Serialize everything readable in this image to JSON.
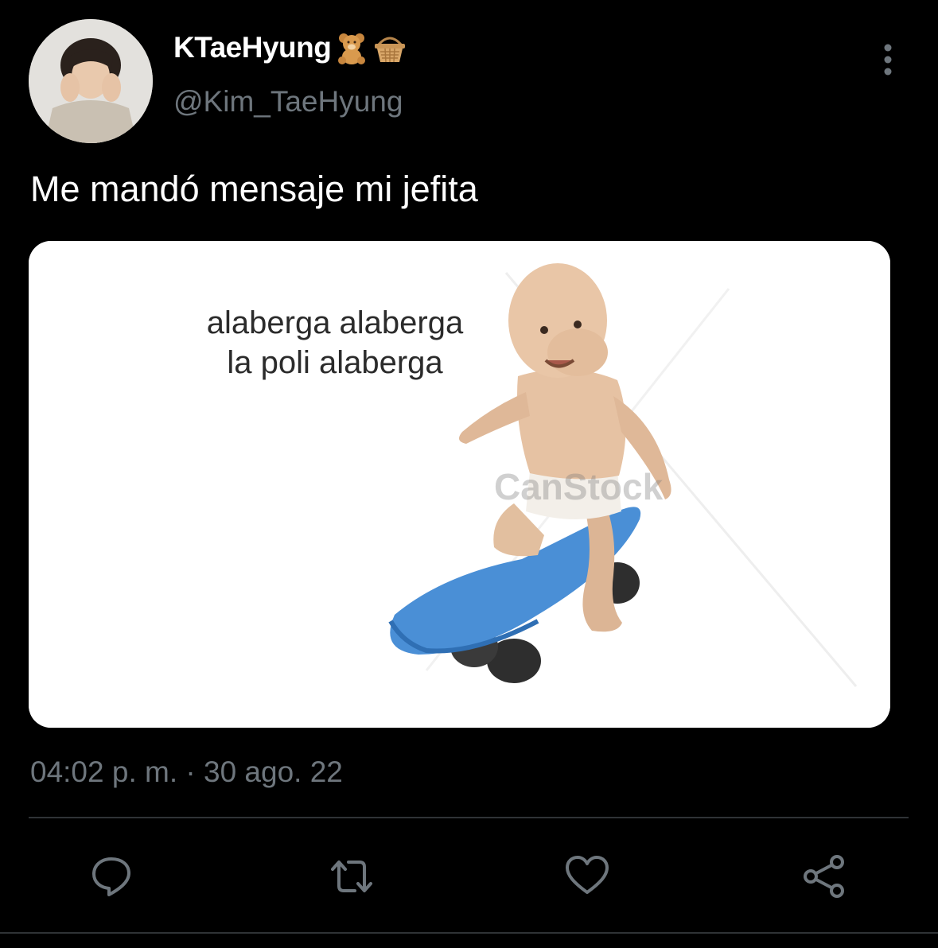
{
  "tweet": {
    "display_name": "KTaeHyung",
    "name_emojis": [
      "teddy-bear-icon",
      "basket-icon"
    ],
    "handle": "@Kim_TaeHyung",
    "text": "Me mandó mensaje mi jefita",
    "timestamp": "04:02 p. m. · 30 ago. 22"
  },
  "media": {
    "caption_line1": "alaberga alaberga",
    "caption_line2": "la poli alaberga",
    "watermark": "CanStock"
  },
  "actions": {
    "reply_icon": "reply-icon",
    "retweet_icon": "retweet-icon",
    "like_icon": "heart-icon",
    "share_icon": "share-icon"
  },
  "colors": {
    "background": "#000000",
    "text_primary": "#ffffff",
    "text_secondary": "#6e767d",
    "divider": "#2f3336",
    "skateboard": "#4a8fd6"
  }
}
